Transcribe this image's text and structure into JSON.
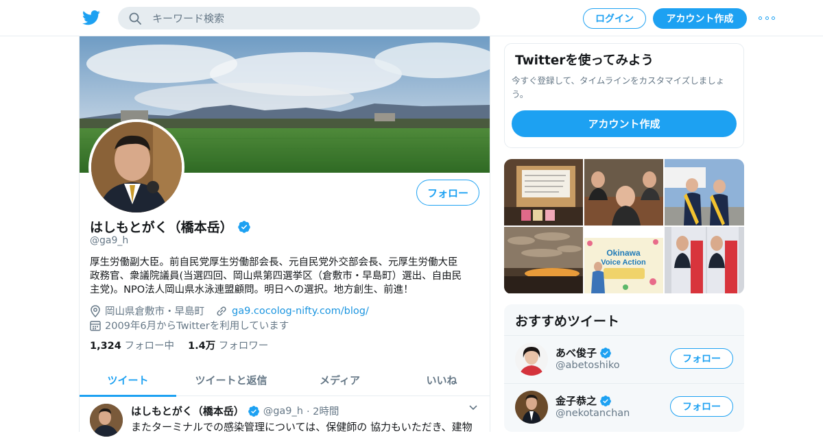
{
  "header": {
    "search_placeholder": "キーワード検索",
    "login_label": "ログイン",
    "signup_label": "アカウント作成"
  },
  "profile": {
    "follow_label": "フォロー",
    "name": "はしもとがく（橋本岳）",
    "handle": "@ga9_h",
    "bio_line1": "厚生労働副大臣。前自民党厚生労働部会長、元自民党外交部会長、元厚生労働大臣",
    "bio_line2": "政務官、衆議院議員(当選四回、岡山県第四選挙区（倉敷市・早島町）選出、自由民",
    "bio_line3": "主党)。NPO法人岡山県水泳連盟顧問。明日への選択。地方創生、前進！",
    "location": "岡山県倉敷市・早島町",
    "url": "ga9.cocolog-nifty.com/blog/",
    "joined": "2009年6月からTwitterを利用しています",
    "following_count": "1,324",
    "following_label": "フォロー中",
    "followers_count": "1.4万",
    "followers_label": "フォロワー"
  },
  "tabs": [
    "ツイート",
    "ツイートと返信",
    "メディア",
    "いいね"
  ],
  "tweet": {
    "name": "はしもとがく（橋本岳）",
    "handle": "@ga9_h",
    "time": "· 2時間",
    "text": "またターミナルでの感染管理については、保健師の 協力もいただき、建物"
  },
  "signup_card": {
    "title": "Twitterを使ってみよう",
    "desc": "今すぐ登録して、タイムラインをカスタマイズしましょう。",
    "cta": "アカウント作成"
  },
  "media_grid": {
    "poster_title_1": "Okinawa",
    "poster_title_2": "Voice Action"
  },
  "recommended": {
    "title": "おすすめツイート",
    "accounts": [
      {
        "name": "あべ俊子",
        "handle": "@abetoshiko",
        "follow_label": "フォロー"
      },
      {
        "name": "金子恭之",
        "handle": "@nekotanchan",
        "follow_label": "フォロー"
      }
    ]
  },
  "colors": {
    "accent": "#1da1f2",
    "text": "#14171a",
    "muted": "#657786",
    "border": "#e6ecf0"
  }
}
